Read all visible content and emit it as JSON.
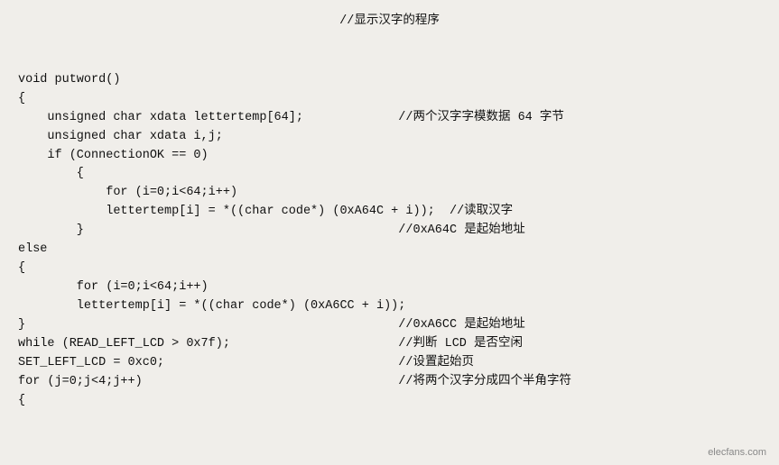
{
  "header": {
    "comment": "//显示汉字的程序"
  },
  "watermark": "elecfans.com",
  "code_lines": [
    {
      "indent": 0,
      "code": "void putword()",
      "comment": ""
    },
    {
      "indent": 0,
      "code": "{",
      "comment": ""
    },
    {
      "indent": 1,
      "code": "unsigned char xdata lettertemp[64];",
      "comment": "//两个汉字字模数据 64 字节"
    },
    {
      "indent": 1,
      "code": "unsigned char xdata i,j;",
      "comment": ""
    },
    {
      "indent": 1,
      "code": "if (ConnectionOK == 0)",
      "comment": ""
    },
    {
      "indent": 2,
      "code": "{",
      "comment": ""
    },
    {
      "indent": 3,
      "code": "for (i=0;i<64;i++)",
      "comment": ""
    },
    {
      "indent": 3,
      "code": "lettertemp[i] = *((char code*) (0xA64C + i));",
      "comment": "//读取汉字"
    },
    {
      "indent": 2,
      "code": "}",
      "comment": "//0xA64C 是起始地址"
    },
    {
      "indent": 0,
      "code": "else",
      "comment": ""
    },
    {
      "indent": 0,
      "code": "{",
      "comment": ""
    },
    {
      "indent": 2,
      "code": "for (i=0;i<64;i++)",
      "comment": ""
    },
    {
      "indent": 2,
      "code": "lettertemp[i] = *((char code*) (0xA6CC + i));",
      "comment": ""
    },
    {
      "indent": 0,
      "code": "}",
      "comment": "//0xA6CC 是起始地址"
    },
    {
      "indent": 0,
      "code": "while (READ_LEFT_LCD > 0x7f);",
      "comment": "//判断 LCD 是否空闲"
    },
    {
      "indent": 0,
      "code": "SET_LEFT_LCD = 0xc0;",
      "comment": "//设置起始页"
    },
    {
      "indent": 0,
      "code": "for (j=0;j<4;j++)",
      "comment": "//将两个汉字分成四个半角字符"
    },
    {
      "indent": 0,
      "code": "{",
      "comment": ""
    }
  ]
}
